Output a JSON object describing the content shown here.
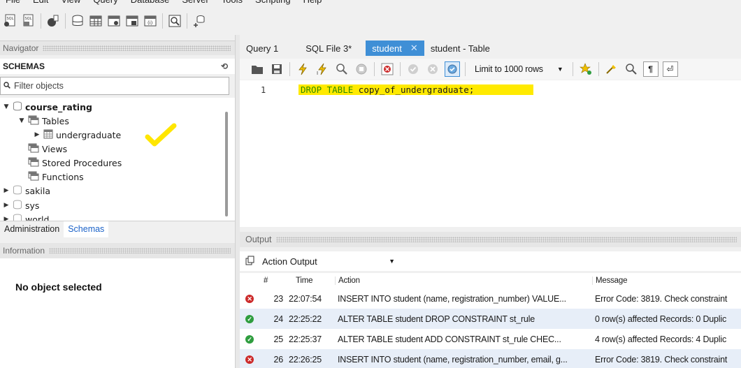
{
  "menu": [
    "File",
    "Edit",
    "View",
    "Query",
    "Database",
    "Server",
    "Tools",
    "Scripting",
    "Help"
  ],
  "main_toolbar_icons": [
    "new-sql-tab-icon",
    "open-sql-script-icon",
    "inspector-icon",
    "create-schema-icon",
    "create-table-icon",
    "create-view-icon",
    "create-procedure-icon",
    "create-function-icon",
    "search-table-data-icon",
    "reconnect-icon"
  ],
  "navigator": {
    "title": "Navigator",
    "schemas_label": "SCHEMAS",
    "filter_placeholder": "Filter objects",
    "tree": {
      "course_rating": "course_rating",
      "tables": "Tables",
      "undergraduate": "undergraduate",
      "views": "Views",
      "stored_procedures": "Stored Procedures",
      "functions": "Functions",
      "sakila": "sakila",
      "sys": "sys",
      "world": "world"
    },
    "tabs": [
      "Administration",
      "Schemas"
    ],
    "active_tab": "Schemas"
  },
  "information": {
    "title": "Information",
    "empty": "No object selected"
  },
  "doc_tabs": [
    "Query 1",
    "SQL File 3*",
    "student",
    "student - Table"
  ],
  "active_doc_tab": "student",
  "editor_toolbar": {
    "limit_label": "Limit to 1000 rows"
  },
  "editor": {
    "line_number": "1",
    "keyword": "DROP TABLE",
    "rest": " copy_of_undergraduate;"
  },
  "output": {
    "title": "Output",
    "selector": "Action Output",
    "columns": [
      "#",
      "Time",
      "Action",
      "Message"
    ],
    "rows": [
      {
        "status": "error",
        "num": "23",
        "time": "22:07:54",
        "action": "INSERT INTO student (name, registration_number) VALUE...",
        "message": "Error Code: 3819. Check constraint"
      },
      {
        "status": "ok",
        "num": "24",
        "time": "22:25:22",
        "action": "ALTER TABLE student DROP CONSTRAINT st_rule",
        "message": "0 row(s) affected Records: 0  Duplic"
      },
      {
        "status": "ok",
        "num": "25",
        "time": "22:25:37",
        "action": "ALTER TABLE student ADD CONSTRAINT st_rule CHEC...",
        "message": "4 row(s) affected Records: 4  Duplic"
      },
      {
        "status": "error",
        "num": "26",
        "time": "22:26:25",
        "action": "INSERT INTO student (name, registration_number, email, g...",
        "message": "Error Code: 3819. Check constraint"
      }
    ]
  },
  "colors": {
    "active_tab": "#3f8fd6",
    "highlight": "#ffea00",
    "keyword": "#2f8a00",
    "error": "#cc2a2a",
    "ok": "#2f9d3f",
    "annotation": "#ffe600"
  }
}
